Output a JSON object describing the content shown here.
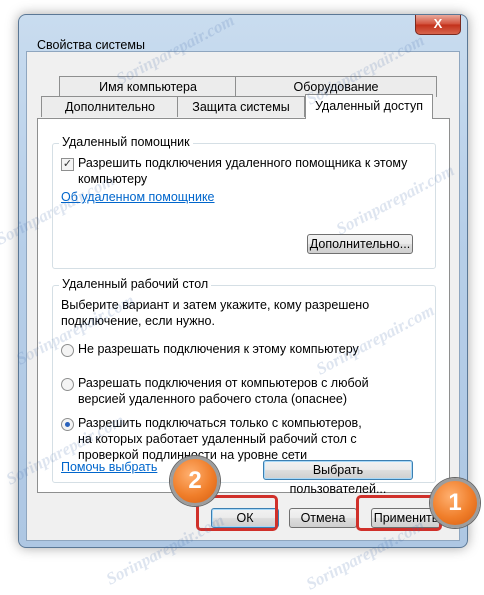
{
  "window": {
    "title": "Свойства системы",
    "close_label": "X"
  },
  "tabs": {
    "row_back": [
      "Имя компьютера",
      "Оборудование"
    ],
    "row_front": [
      "Дополнительно",
      "Защита системы",
      "Удаленный доступ"
    ],
    "active": "Удаленный доступ"
  },
  "remote_assistance": {
    "legend": "Удаленный помощник",
    "checkbox_checked": true,
    "checkbox_label": "Разрешить подключения удаленного помощника к этому компьютеру",
    "link": "Об удаленном помощнике",
    "advanced_button": "Дополнительно..."
  },
  "remote_desktop": {
    "legend": "Удаленный рабочий стол",
    "description": "Выберите вариант и затем укажите, кому разрешено подключение, если нужно.",
    "options": [
      "Не разрешать подключения к этому компьютеру",
      "Разрешать подключения от компьютеров с любой версией удаленного рабочего стола (опаснее)",
      "Разрешить подключаться только с компьютеров, на которых работает удаленный рабочий стол с проверкой подлинности на уровне сети"
    ],
    "selected_option": 2,
    "help_link": "Помочь выбрать",
    "select_users_button": "Выбрать пользователей..."
  },
  "footer": {
    "ok": "ОК",
    "cancel": "Отмена",
    "apply": "Применить"
  },
  "badges": [
    "1",
    "2"
  ],
  "watermark": "Sorinparepair.com",
  "colors": {
    "highlight": "#d0302a",
    "badge": "#f07e2a",
    "link": "#0066cc"
  }
}
